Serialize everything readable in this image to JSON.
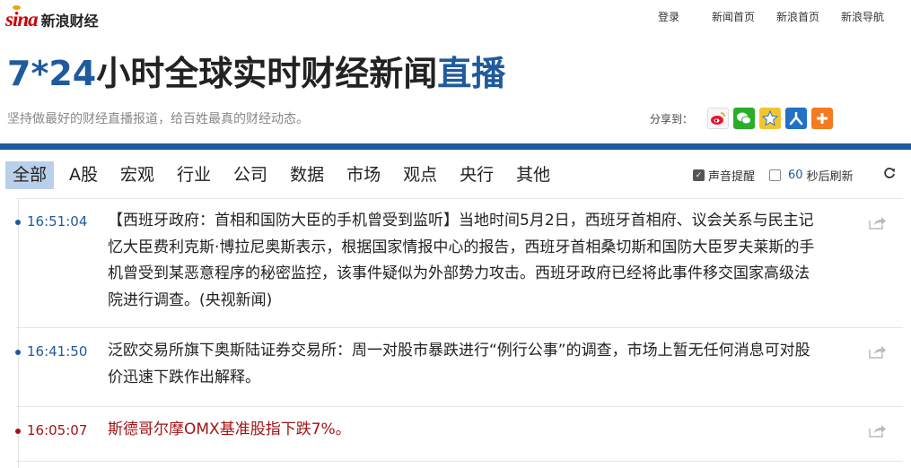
{
  "header": {
    "logo_text": "sina",
    "logo_cn": "新浪财经",
    "links": [
      "登录",
      "新闻首页",
      "新浪首页",
      "新浪导航"
    ]
  },
  "title": {
    "part1": "7*24",
    "part2": "小时全球实时财经新闻",
    "part3": "直播"
  },
  "slogan": "坚持做最好的财经直播报道，给百姓最真的财经动态。",
  "share": {
    "label": "分享到：",
    "icons": [
      "weibo-icon",
      "wechat-icon",
      "qzone-icon",
      "renren-icon",
      "more-share-icon"
    ]
  },
  "tabs": [
    "全部",
    "A股",
    "宏观",
    "行业",
    "公司",
    "数据",
    "市场",
    "观点",
    "央行",
    "其他"
  ],
  "active_tab": 0,
  "controls": {
    "sound_label": "声音提醒",
    "sound_checked": true,
    "refresh_seconds": "60",
    "refresh_label": "秒后刷新",
    "refresh_checked": false
  },
  "news": [
    {
      "time": "16:51:04",
      "text": "【西班牙政府：首相和国防大臣的手机曾受到监听】当地时间5月2日，西班牙首相府、议会关系与民主记忆大臣费利克斯·博拉尼奥斯表示，根据国家情报中心的报告，西班牙首相桑切斯和国防大臣罗夫莱斯的手机曾受到某恶意程序的秘密监控，该事件疑似为外部势力攻击。西班牙政府已经将此事件移交国家高级法院进行调查。(央视新闻)",
      "important": false
    },
    {
      "time": "16:41:50",
      "text": "泛欧交易所旗下奥斯陆证券交易所：周一对股市暴跌进行“例行公事”的调查，市场上暂无任何消息可对股价迅速下跌作出解释。",
      "important": false
    },
    {
      "time": "16:05:07",
      "text": "斯德哥尔摩OMX基准股指下跌7%。",
      "important": true
    }
  ],
  "colors": {
    "brand_blue": "#1f5b9c",
    "alert_red": "#a21414",
    "active_tab_bg": "#bad0ea"
  }
}
